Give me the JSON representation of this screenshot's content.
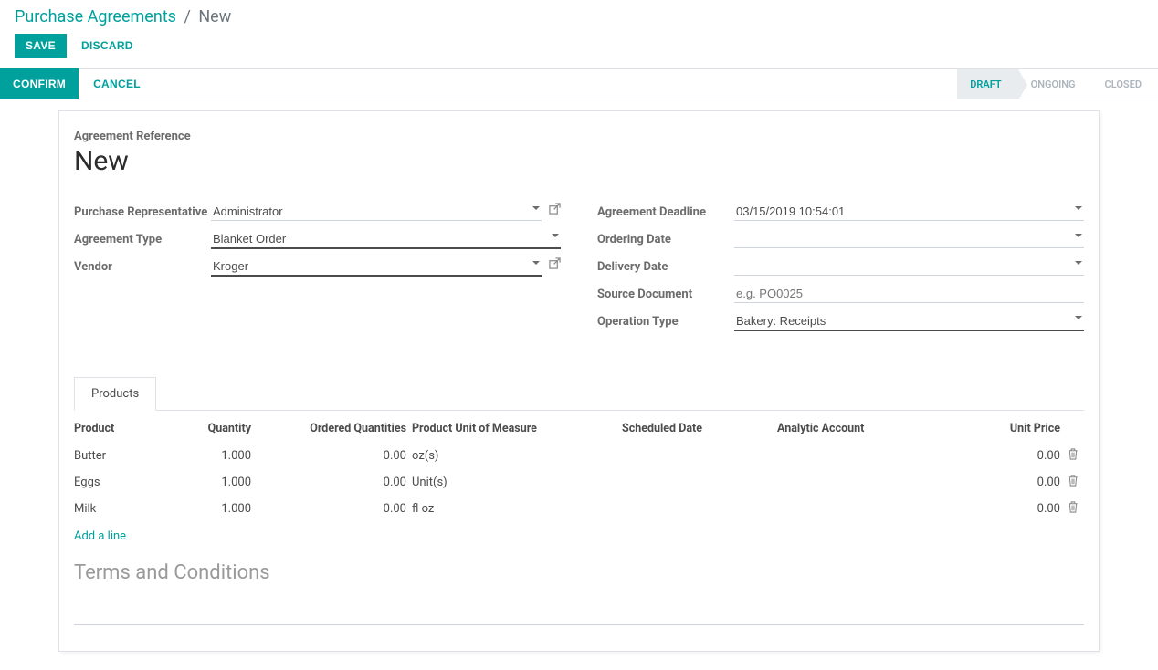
{
  "breadcrumb": {
    "root": "Purchase Agreements",
    "current": "New"
  },
  "toolbar": {
    "save": "SAVE",
    "discard": "DISCARD"
  },
  "statusbar": {
    "confirm": "CONFIRM",
    "cancel": "CANCEL",
    "steps": {
      "draft": "DRAFT",
      "ongoing": "ONGOING",
      "closed": "CLOSED"
    }
  },
  "form": {
    "reference_label": "Agreement Reference",
    "reference_value": "New",
    "left": {
      "purchase_rep_label": "Purchase Representative",
      "purchase_rep_value": "Administrator",
      "agreement_type_label": "Agreement Type",
      "agreement_type_value": "Blanket Order",
      "vendor_label": "Vendor",
      "vendor_value": "Kroger"
    },
    "right": {
      "deadline_label": "Agreement Deadline",
      "deadline_value": "03/15/2019 10:54:01",
      "ordering_label": "Ordering Date",
      "ordering_value": "",
      "delivery_label": "Delivery Date",
      "delivery_value": "",
      "source_label": "Source Document",
      "source_placeholder": "e.g. PO0025",
      "source_value": "",
      "optype_label": "Operation Type",
      "optype_value": "Bakery: Receipts"
    }
  },
  "tabs": {
    "products": "Products"
  },
  "table": {
    "headers": {
      "product": "Product",
      "quantity": "Quantity",
      "ordered": "Ordered Quantities",
      "uom": "Product Unit of Measure",
      "scheduled": "Scheduled Date",
      "analytic": "Analytic Account",
      "price": "Unit Price"
    },
    "rows": [
      {
        "product": "Butter",
        "quantity": "1.000",
        "ordered": "0.00",
        "uom": "oz(s)",
        "price": "0.00"
      },
      {
        "product": "Eggs",
        "quantity": "1.000",
        "ordered": "0.00",
        "uom": "Unit(s)",
        "price": "0.00"
      },
      {
        "product": "Milk",
        "quantity": "1.000",
        "ordered": "0.00",
        "uom": "fl oz",
        "price": "0.00"
      }
    ],
    "add_line": "Add a line"
  },
  "terms": {
    "placeholder": "Terms and Conditions"
  }
}
